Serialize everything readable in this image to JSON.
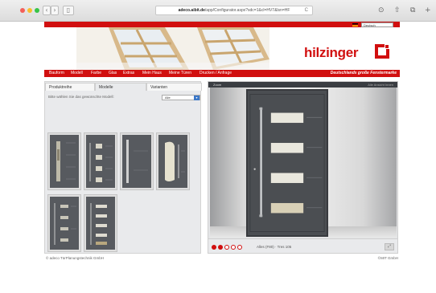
{
  "browser": {
    "address_domain": "adeco.aibit.de",
    "address_path": "/app/Configurator.aspx?sdc=1&cl=HV7&lsn=HF",
    "back_label": "‹",
    "forward_label": "›",
    "reload_label": "C"
  },
  "header": {
    "language": "Deutsch",
    "logo": "hilzinger",
    "tagline": "Deutschlands große Fenstermarke"
  },
  "menu": [
    {
      "label": "Bauform"
    },
    {
      "label": "Modell"
    },
    {
      "label": "Farbe"
    },
    {
      "label": "Glas"
    },
    {
      "label": "Extras"
    },
    {
      "label": "Mein Haus"
    },
    {
      "label": "Meine Türen"
    },
    {
      "label": "Drucken / Anfrage"
    }
  ],
  "left": {
    "tabs": [
      "Produktreihe",
      "Modelle",
      "Varianten"
    ],
    "instruction": "Bitte wählen Sie das gewünschte Modell:",
    "filter_value": "Alle",
    "models_count": 6
  },
  "right": {
    "zoom_label": "Zoom",
    "view_options": "Alle   Ansicht   Innen",
    "model_info": "Alles (F80) · Tres 105",
    "pager_total": 5,
    "pager_active": 2
  },
  "footer": {
    "left": "© adeco TürPlanungstechnik GmbH",
    "right": "©MIT GmbH"
  },
  "colors": {
    "brand_red": "#d10f0f",
    "door_gray": "#4b4e52"
  }
}
